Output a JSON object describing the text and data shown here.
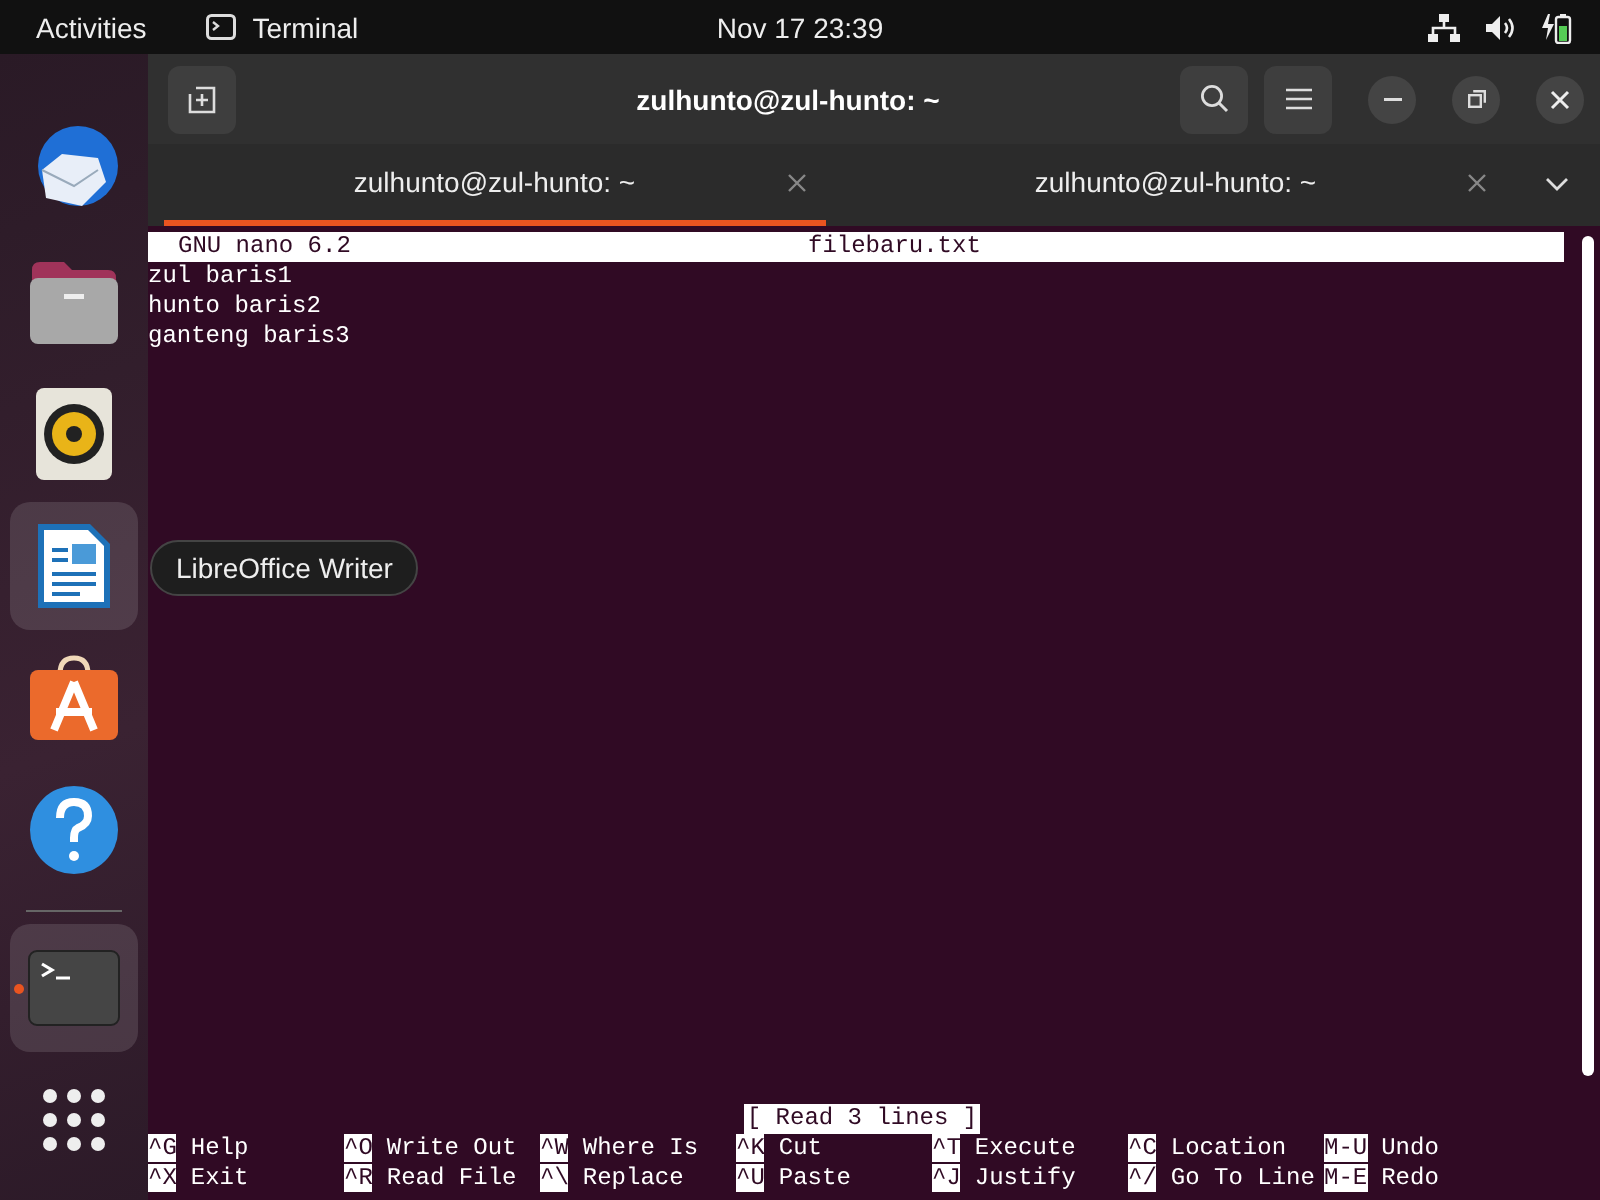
{
  "top_bar": {
    "activities": "Activities",
    "app_name": "Terminal",
    "clock": "Nov 17  23:39"
  },
  "dock": [
    {
      "kind": "mail",
      "highlighted": false,
      "running": false
    },
    {
      "kind": "files",
      "highlighted": false,
      "running": false
    },
    {
      "kind": "music",
      "highlighted": false,
      "running": false
    },
    {
      "kind": "writer",
      "highlighted": true,
      "running": false
    },
    {
      "kind": "store",
      "highlighted": false,
      "running": false
    },
    {
      "kind": "help",
      "highlighted": false,
      "running": false
    },
    {
      "kind": "separator"
    },
    {
      "kind": "terminal",
      "highlighted": true,
      "running": true
    },
    {
      "kind": "apps",
      "highlighted": false,
      "running": false
    }
  ],
  "tooltip": "LibreOffice Writer",
  "window": {
    "title": "zulhunto@zul-hunto: ~"
  },
  "tabs": [
    {
      "label": "zulhunto@zul-hunto: ~",
      "selected": true
    },
    {
      "label": "zulhunto@zul-hunto: ~",
      "selected": false
    }
  ],
  "nano": {
    "version": "GNU nano 6.2",
    "filename": "filebaru.txt",
    "lines": [
      "zul baris1",
      "hunto baris2",
      "ganteng baris3"
    ],
    "status": "[ Read 3 lines ]",
    "shortcuts": [
      [
        {
          "key": "^G",
          "label": "Help"
        },
        {
          "key": "^O",
          "label": "Write Out"
        },
        {
          "key": "^W",
          "label": "Where Is"
        },
        {
          "key": "^K",
          "label": "Cut"
        },
        {
          "key": "^T",
          "label": "Execute"
        },
        {
          "key": "^C",
          "label": "Location"
        },
        {
          "key": "M-U",
          "label": "Undo"
        }
      ],
      [
        {
          "key": "^X",
          "label": "Exit"
        },
        {
          "key": "^R",
          "label": "Read File"
        },
        {
          "key": "^\\",
          "label": "Replace"
        },
        {
          "key": "^U",
          "label": "Paste"
        },
        {
          "key": "^J",
          "label": "Justify"
        },
        {
          "key": "^/",
          "label": "Go To Line"
        },
        {
          "key": "M-E",
          "label": "Redo"
        }
      ]
    ]
  }
}
